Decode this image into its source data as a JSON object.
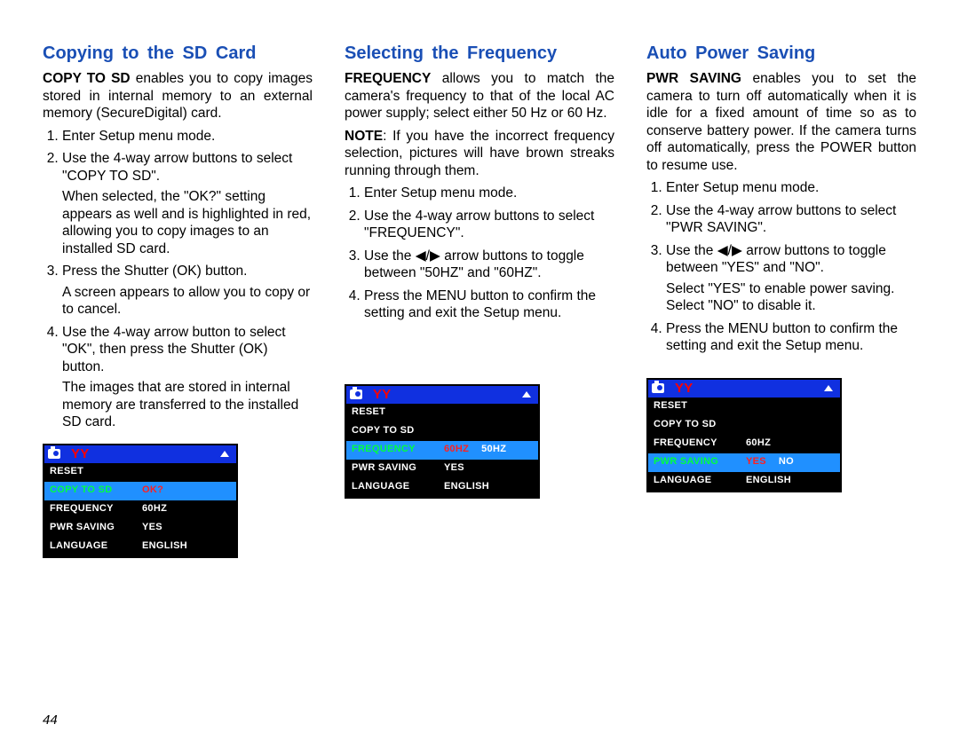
{
  "page_number": "44",
  "col1": {
    "heading": "Copying to the SD Card",
    "intro_bold": "COPY TO SD",
    "intro_rest": " enables you to copy images stored in internal memory to an external memory (SecureDigital) card.",
    "s1": "Enter Setup menu mode.",
    "s2": "Use the 4-way arrow buttons to select \"COPY TO SD\".",
    "s2f": "When selected, the \"OK?\" setting appears as well and is highlighted in red, allowing you to copy images to an installed SD card.",
    "s3": "Press the Shutter (OK) button.",
    "s3f": "A screen appears to allow you to copy or to cancel.",
    "s4": "Use the 4-way arrow button to select \"OK\", then press the Shutter (OK) button.",
    "s4f": "The images that are stored in internal memory are transferred to the installed SD card.",
    "cam": {
      "r1": "RESET",
      "r2": "COPY TO SD",
      "r2v": "OK?",
      "r3": "FREQUENCY",
      "r3v": "60HZ",
      "r4": "PWR SAVING",
      "r4v": "YES",
      "r5": "LANGUAGE",
      "r5v": "ENGLISH"
    }
  },
  "col2": {
    "heading": "Selecting the Frequency",
    "intro_bold": "FREQUENCY",
    "intro_rest": " allows you to match the camera's frequency to that of the local AC power supply; select either 50 Hz or 60 Hz.",
    "note_bold": "NOTE",
    "note_rest": ": If you have the incorrect frequency selection, pictures will have brown streaks running through them.",
    "s1": "Enter Setup menu mode.",
    "s2": "Use the 4-way arrow buttons to select \"FREQUENCY\".",
    "s3a": "Use the ",
    "s3b": " arrow buttons to toggle between \"50HZ\" and \"60HZ\".",
    "s4": "Press the MENU button to confirm the setting and exit the Setup menu.",
    "cam": {
      "r1": "RESET",
      "r2": "COPY TO SD",
      "r3": "FREQUENCY",
      "r3v1": "60HZ",
      "r3v2": "50HZ",
      "r4": "PWR SAVING",
      "r4v": "YES",
      "r5": "LANGUAGE",
      "r5v": "ENGLISH"
    }
  },
  "col3": {
    "heading": "Auto Power Saving",
    "intro_bold": "PWR SAVING",
    "intro_rest": " enables you to set the camera to turn off automatically when it is idle for a fixed amount of time so as to conserve battery power. If the camera turns off automatically, press the POWER button to resume use.",
    "s1": "Enter Setup menu mode.",
    "s2": "Use the 4-way arrow buttons to select \"PWR SAVING\".",
    "s3a": "Use the ",
    "s3b": " arrow buttons to toggle between \"YES\" and \"NO\".",
    "s3f": "Select \"YES\" to enable power saving. Select \"NO\" to disable it.",
    "s4": "Press the MENU button to confirm the setting and exit the Setup menu.",
    "cam": {
      "r1": "RESET",
      "r2": "COPY TO SD",
      "r3": "FREQUENCY",
      "r3v": "60HZ",
      "r4": "PWR SAVING",
      "r4v1": "YES",
      "r4v2": "NO",
      "r5": "LANGUAGE",
      "r5v": "ENGLISH"
    }
  }
}
